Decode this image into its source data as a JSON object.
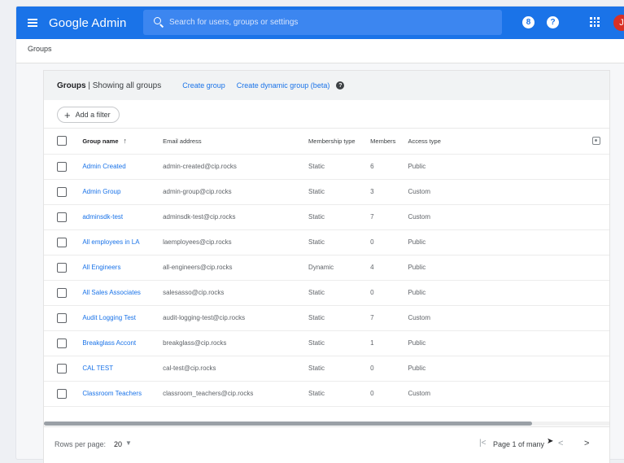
{
  "header": {
    "app_title": "Google Admin",
    "search_placeholder": "Search for users, groups or settings",
    "avatar_initial": "J",
    "icons": [
      "menu-icon",
      "search-icon",
      "badge-icon",
      "help-icon",
      "apps-icon"
    ],
    "accent_color": "#1a73e8"
  },
  "breadcrumb": "Groups",
  "card": {
    "title_bold": "Groups",
    "title_rest": " | Showing all groups",
    "create_group": "Create group",
    "create_dynamic": "Create dynamic group (beta)",
    "add_filter": "Add a filter"
  },
  "table": {
    "columns": [
      "Group name",
      "Email address",
      "Membership type",
      "Members",
      "Access type"
    ],
    "sort_indicator": "↑",
    "rows": [
      {
        "name": "Admin Created",
        "email": "admin-created@cip.rocks",
        "type": "Static",
        "members": "6",
        "access": "Public"
      },
      {
        "name": "Admin Group",
        "email": "admin-group@cip.rocks",
        "type": "Static",
        "members": "3",
        "access": "Custom"
      },
      {
        "name": "adminsdk-test",
        "email": "adminsdk-test@cip.rocks",
        "type": "Static",
        "members": "7",
        "access": "Custom"
      },
      {
        "name": "All employees in LA",
        "email": "laemployees@cip.rocks",
        "type": "Static",
        "members": "0",
        "access": "Public"
      },
      {
        "name": "All Engineers",
        "email": "all-engineers@cip.rocks",
        "type": "Dynamic",
        "members": "4",
        "access": "Public"
      },
      {
        "name": "All Sales Associates",
        "email": "salesasso@cip.rocks",
        "type": "Static",
        "members": "0",
        "access": "Public"
      },
      {
        "name": "Audit Logging Test",
        "email": "audit-logging-test@cip.rocks",
        "type": "Static",
        "members": "7",
        "access": "Custom"
      },
      {
        "name": "Breakglass Accont",
        "email": "breakglass@cip.rocks",
        "type": "Static",
        "members": "1",
        "access": "Public"
      },
      {
        "name": "CAL TEST",
        "email": "cal-test@cip.rocks",
        "type": "Static",
        "members": "0",
        "access": "Public"
      },
      {
        "name": "Classroom Teachers",
        "email": "classroom_teachers@cip.rocks",
        "type": "Static",
        "members": "0",
        "access": "Custom"
      }
    ]
  },
  "footer": {
    "rows_per_page_label": "Rows per page:",
    "rows_per_page_value": "20",
    "page_info": "Page 1 of many"
  }
}
